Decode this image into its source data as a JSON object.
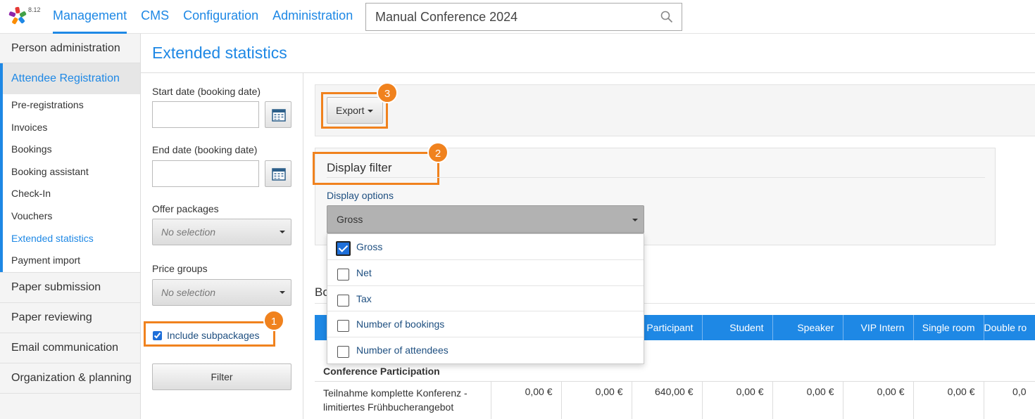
{
  "app": {
    "version": "8.12"
  },
  "topnav": {
    "items": [
      {
        "label": "Management",
        "active": true
      },
      {
        "label": "CMS"
      },
      {
        "label": "Configuration"
      },
      {
        "label": "Administration"
      }
    ],
    "event_selector": {
      "value": "Manual Conference 2024"
    }
  },
  "sidebar": {
    "person_admin": "Person administration",
    "attendee_registration": "Attendee Registration",
    "sub_items": [
      {
        "label": "Pre-registrations"
      },
      {
        "label": "Invoices"
      },
      {
        "label": "Bookings"
      },
      {
        "label": "Booking assistant"
      },
      {
        "label": "Check-In"
      },
      {
        "label": "Vouchers"
      },
      {
        "label": "Extended statistics",
        "active": true
      },
      {
        "label": "Payment import"
      }
    ],
    "after_items": [
      {
        "label": "Paper submission"
      },
      {
        "label": "Paper reviewing"
      },
      {
        "label": "Email communication"
      },
      {
        "label": "Organization & planning"
      }
    ]
  },
  "page": {
    "title": "Extended statistics"
  },
  "filters": {
    "start_date_label": "Start date (booking date)",
    "start_date_value": "",
    "end_date_label": "End date (booking date)",
    "end_date_value": "",
    "offer_packages_label": "Offer packages",
    "offer_packages_value": "No selection",
    "price_groups_label": "Price groups",
    "price_groups_value": "No selection",
    "include_subpackages_label": "Include subpackages",
    "include_subpackages_checked": true,
    "filter_button": "Filter"
  },
  "badges": {
    "one": "1",
    "two": "2",
    "three": "3"
  },
  "export": {
    "label": "Export"
  },
  "display_filter": {
    "title": "Display filter",
    "options_label": "Display options",
    "selected": "Gross",
    "options": [
      {
        "label": "Gross",
        "checked": true
      },
      {
        "label": "Net",
        "checked": false
      },
      {
        "label": "Tax",
        "checked": false
      },
      {
        "label": "Number of bookings",
        "checked": false
      },
      {
        "label": "Number of attendees",
        "checked": false
      }
    ]
  },
  "bookings": {
    "heading": "Bo",
    "columns": [
      "",
      "",
      "",
      "Participant",
      "Student",
      "Speaker",
      "VIP Intern",
      "Single room",
      "Double ro"
    ],
    "group_label": "Conference Participation",
    "rows": [
      {
        "name": "Teilnahme komplette Konferenz - limitiertes Frühbucherangebot",
        "values": [
          "0,00 €",
          "0,00 €",
          "640,00 €",
          "0,00 €",
          "0,00 €",
          "0,00 €",
          "0,00 €",
          "0,0"
        ]
      }
    ]
  },
  "colors": {
    "accent": "#1e88e5",
    "highlight": "#f0821e"
  }
}
